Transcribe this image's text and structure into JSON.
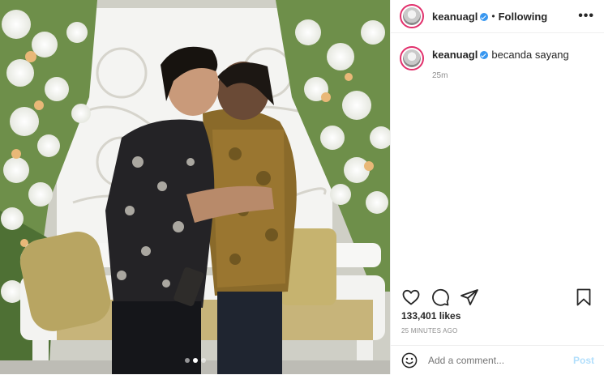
{
  "photo": {
    "carousel_dots": 3,
    "active_dot": 1
  },
  "header": {
    "username": "keanuagl",
    "separator": "•",
    "follow_status": "Following",
    "more_label": "•••"
  },
  "caption": {
    "username": "keanuagl",
    "text": "becanda sayang",
    "time": "25m"
  },
  "actions": {
    "icons": [
      "heart-icon",
      "comment-icon",
      "share-icon",
      "bookmark-icon"
    ]
  },
  "likes": "133,401 likes",
  "posted": "25 MINUTES AGO",
  "comment": {
    "placeholder": "Add a comment...",
    "post_label": "Post"
  },
  "colors": {
    "accent": "#3897f0",
    "post_disabled": "#b2dffc",
    "story_ring": "#e1306c",
    "muted": "#8e8e8e"
  }
}
